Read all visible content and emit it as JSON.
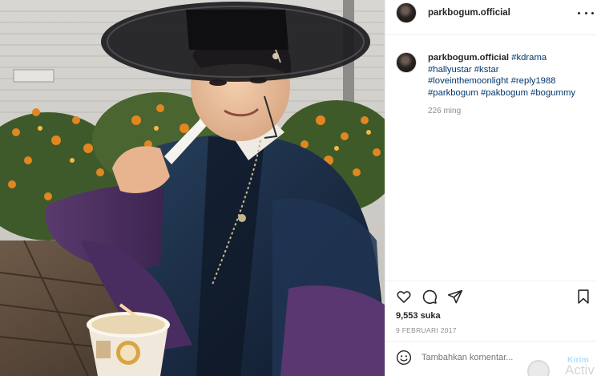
{
  "post": {
    "username": "parkbogum.official",
    "photo_alt": "Foto postingan",
    "caption": {
      "username": "parkbogum.official",
      "line1_tag": "#kdrama",
      "line2": "#hallyustar #kstar",
      "line3": "#loveinthemoonlight #reply1988",
      "line4": "#parkbogum #pakbogum #bogummy"
    },
    "time_ago": "226 ming",
    "likes": "9,553 suka",
    "date": "9 FEBRUARI 2017",
    "comment_placeholder": "Tambahkan komentar...",
    "post_button": "Kirim",
    "watermark": "Activ"
  },
  "icons": {
    "more": "more-options-icon",
    "like": "heart-icon",
    "comment": "comment-icon",
    "share": "share-icon",
    "save": "bookmark-icon",
    "emoji": "emoji-icon"
  },
  "colors": {
    "hashtag": "#00376b",
    "muted": "#8e8e8e",
    "post_button": "#b2dffc",
    "divider": "#efefef"
  }
}
